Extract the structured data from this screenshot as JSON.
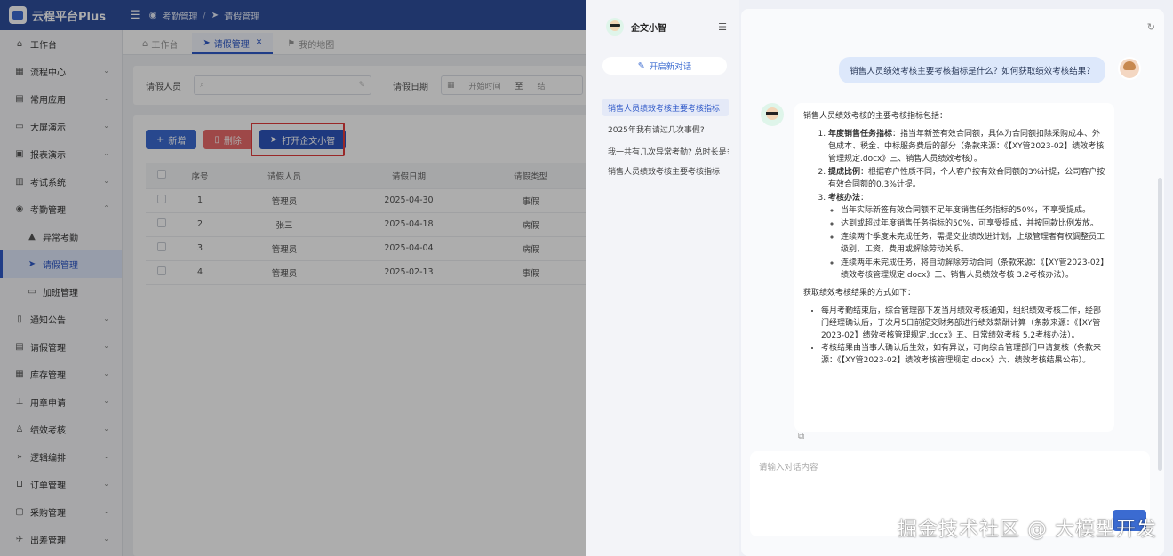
{
  "app": {
    "logo": "云程平台Plus",
    "breadcrumb": [
      "考勤管理",
      "请假管理"
    ]
  },
  "sidebar": {
    "items": [
      {
        "label": "工作台",
        "icon": "home-icon"
      },
      {
        "label": "流程中心",
        "icon": "grid-icon"
      },
      {
        "label": "常用应用",
        "icon": "apps-icon"
      },
      {
        "label": "大屏演示",
        "icon": "monitor-icon"
      },
      {
        "label": "报表演示",
        "icon": "report-icon"
      },
      {
        "label": "考试系统",
        "icon": "exam-icon"
      },
      {
        "label": "考勤管理",
        "icon": "clock-icon"
      },
      {
        "label": "异常考勤",
        "icon": "warning-icon"
      },
      {
        "label": "请假管理",
        "icon": "send-icon"
      },
      {
        "label": "加班管理",
        "icon": "screen-icon"
      },
      {
        "label": "通知公告",
        "icon": "notice-icon"
      },
      {
        "label": "请假管理",
        "icon": "doc-icon"
      },
      {
        "label": "库存管理",
        "icon": "box-icon"
      },
      {
        "label": "用章申请",
        "icon": "stamp-icon"
      },
      {
        "label": "绩效考核",
        "icon": "user-icon"
      },
      {
        "label": "逻辑编排",
        "icon": "flow-icon"
      },
      {
        "label": "订单管理",
        "icon": "cart-icon"
      },
      {
        "label": "采购管理",
        "icon": "purchase-icon"
      },
      {
        "label": "出差管理",
        "icon": "plane-icon"
      }
    ]
  },
  "tabs": [
    {
      "label": "工作台"
    },
    {
      "label": "请假管理"
    },
    {
      "label": "我的地图"
    }
  ],
  "filter": {
    "person_label": "请假人员",
    "date_label": "请假日期",
    "start_placeholder": "开始时间",
    "to": "至",
    "end_placeholder": "结"
  },
  "toolbar": {
    "add": "新增",
    "delete": "删除",
    "open_assistant": "打开企文小智"
  },
  "table": {
    "headers": [
      "序号",
      "请假人员",
      "请假日期",
      "请假类型"
    ],
    "rows": [
      [
        "1",
        "管理员",
        "2025-04-30",
        "事假"
      ],
      [
        "2",
        "张三",
        "2025-04-18",
        "病假"
      ],
      [
        "3",
        "管理员",
        "2025-04-04",
        "病假"
      ],
      [
        "4",
        "管理员",
        "2025-02-13",
        "事假"
      ]
    ]
  },
  "chat": {
    "bot_name": "企文小智",
    "new_chat": "开启新对话",
    "history": [
      "销售人员绩效考核主要考核指标",
      "2025年我有请过几次事假?",
      "我一共有几次异常考勤? 总时长是多少",
      "销售人员绩效考核主要考核指标"
    ],
    "question": "销售人员绩效考核主要考核指标是什么？如何获取绩效考核结果？",
    "answer": {
      "intro": "销售人员绩效考核的主要考核指标包括：",
      "items": [
        {
          "title": "年度销售任务指标",
          "text": "：指当年新签有效合同额，具体为合同额扣除采购成本、外包成本、税金、中标服务费后的部分（条款来源：《【XY管2023-02】绩效考核管理规定.docx》三、销售人员绩效考核）。"
        },
        {
          "title": "提成比例",
          "text": "：根据客户性质不同，个人客户按有效合同额的3%计提，公司客户按有效合同额的0.3%计提。"
        },
        {
          "title": "考核办法",
          "text": "："
        }
      ],
      "subitems": [
        "当年实际新签有效合同额不足年度销售任务指标的50%，不享受提成。",
        "达到或超过年度销售任务指标的50%，可享受提成，并按回款比例发放。",
        "连续两个季度未完成任务，需提交业绩改进计划，上级管理者有权调整员工级别、工资、费用或解除劳动关系。",
        "连续两年未完成任务，将自动解除劳动合同（条款来源：《【XY管2023-02】绩效考核管理规定.docx》三、销售人员绩效考核 3.2考核办法）。"
      ],
      "method_intro": "获取绩效考核结果的方式如下：",
      "methods": [
        "每月考勤结束后，综合管理部下发当月绩效考核通知，组织绩效考核工作，经部门经理确认后，于次月5日前提交财务部进行绩效薪酬计算（条款来源：《【XY管2023-02】绩效考核管理规定.docx》五、日常绩效考核 5.2考核办法）。",
        "考核结果由当事人确认后生效，如有异议，可向综合管理部门申请复核（条款来源：《【XY管2023-02】绩效考核管理规定.docx》六、绩效考核结果公布）。"
      ]
    },
    "input_placeholder": "请输入对话内容"
  },
  "watermark": "掘金技术社区 @ 大模型开发",
  "colors": {
    "primary": "#3b6bd1",
    "topbar": "#2f4f9d",
    "danger": "#e96b6b",
    "highlight": "#e23b3b"
  }
}
